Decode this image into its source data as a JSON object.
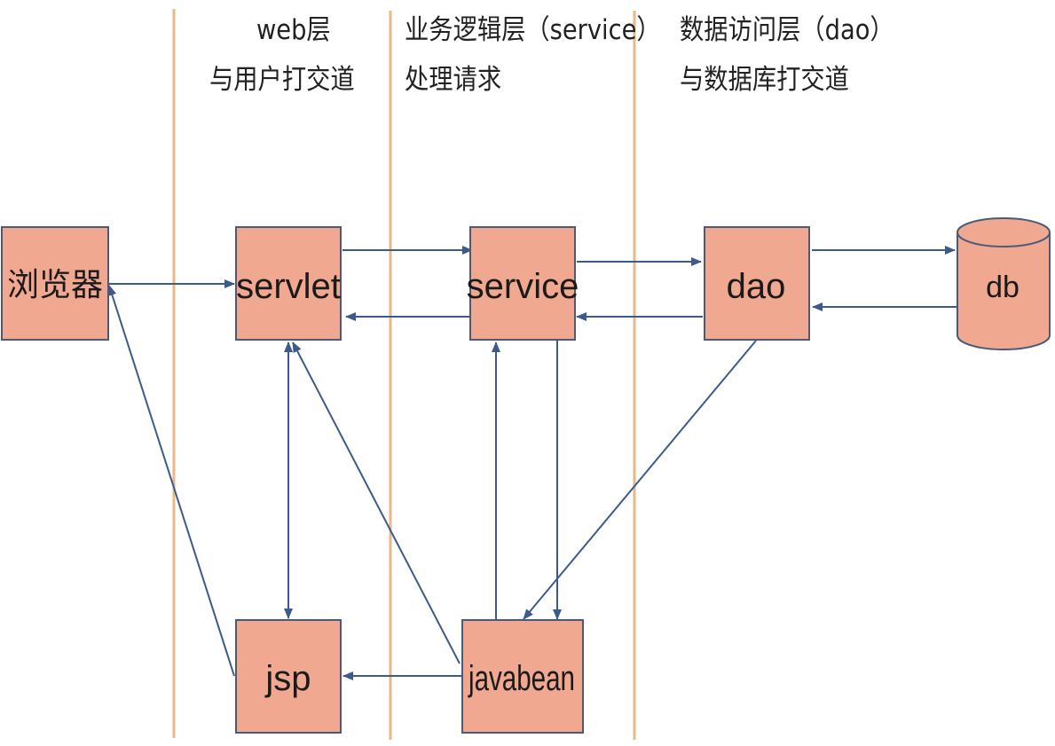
{
  "colors": {
    "box_fill": "#f0a890",
    "box_stroke": "#4a5a78",
    "arrow": "#3c5a8a",
    "divider": "#e8b887"
  },
  "layers": {
    "web": {
      "title": "web层",
      "subtitle": "与用户打交道"
    },
    "service": {
      "title": "业务逻辑层（service）",
      "subtitle": "处理请求"
    },
    "dao": {
      "title": "数据访问层（dao）",
      "subtitle": "与数据库打交道"
    }
  },
  "nodes": {
    "browser": "浏览器",
    "servlet": "servlet",
    "service": "service",
    "dao": "dao",
    "db": "db",
    "jsp": "jsp",
    "javabean": "javabean"
  }
}
